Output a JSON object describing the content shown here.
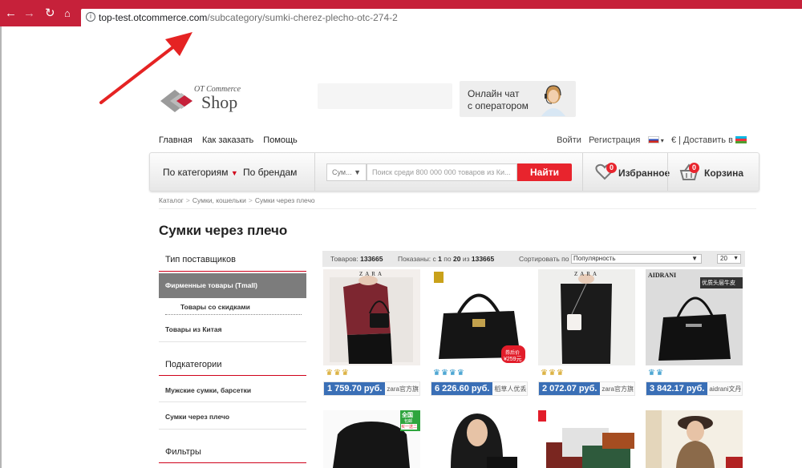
{
  "browser": {
    "url_host": "top-test.otcommerce.com",
    "url_path": "/subcategory/sumki-cherez-plecho-otc-274-2",
    "accent": "#c6213a"
  },
  "header": {
    "logo_line1": "OT Commerce",
    "logo_line2": "Shop",
    "chat_line1": "Онлайн чат",
    "chat_line2": "с оператором"
  },
  "topnav": {
    "items": [
      "Главная",
      "Как заказать",
      "Помощь"
    ]
  },
  "account": {
    "login": "Войти",
    "register": "Регистрация",
    "currency": "€ | Доставить в"
  },
  "mainbar": {
    "by_category": "По категориям",
    "by_brand": "По брендам",
    "category_select": "Сум...",
    "search_placeholder": "Поиск среди 800 000 000 товаров из Ки...",
    "find_button": "Найти",
    "favorites": "Избранное",
    "favorites_count": "0",
    "cart": "Корзина",
    "cart_count": "0"
  },
  "breadcrumb": [
    "Каталог",
    "Сумки, кошельки",
    "Сумки через плечо"
  ],
  "page_title": "Сумки через плечо",
  "sidebar": {
    "supplier_head": "Тип поставщиков",
    "supplier_items": [
      "Фирменные товары (Tmall)",
      "Товары со скидками",
      "Товары из Китая"
    ],
    "subcat_head": "Подкатегории",
    "subcat_items": [
      "Мужские сумки, барсетки",
      "Сумки через плечо"
    ],
    "filters_head": "Фильтры"
  },
  "toolbar": {
    "goods_label": "Товаров:",
    "goods_count": "133665",
    "shown_label": "Показаны: с",
    "shown_from": "1",
    "shown_to_label": "по",
    "shown_to": "20",
    "shown_of_label": "из",
    "shown_total": "133665",
    "sort_label": "Сортировать по",
    "sort_value": "Популярность",
    "per_page": "20"
  },
  "products": [
    {
      "price": "1 759.70 руб.",
      "shop": "zara官方旗",
      "brand": "ZARA",
      "rating": "♛♛♛"
    },
    {
      "price": "6 226.60 руб.",
      "shop": "稻草人优丢",
      "brand": "",
      "rating": "♛♛♛♛",
      "promo_line1": "券后价",
      "promo_line2": "¥259元"
    },
    {
      "price": "2 072.07 руб.",
      "shop": "zara官方旗",
      "brand": "ZARA",
      "rating": "♛♛♛"
    },
    {
      "price": "3 842.17 руб.",
      "shop": "aidrani文丹",
      "brand": "AIDRANI",
      "brand_cn": "优质头层牛皮",
      "rating": "♛♛"
    }
  ],
  "products_row2": [
    {
      "badge_line1": "全国",
      "badge_line2": "包邮",
      "badge_line3": "买一送二"
    },
    {},
    {},
    {}
  ]
}
